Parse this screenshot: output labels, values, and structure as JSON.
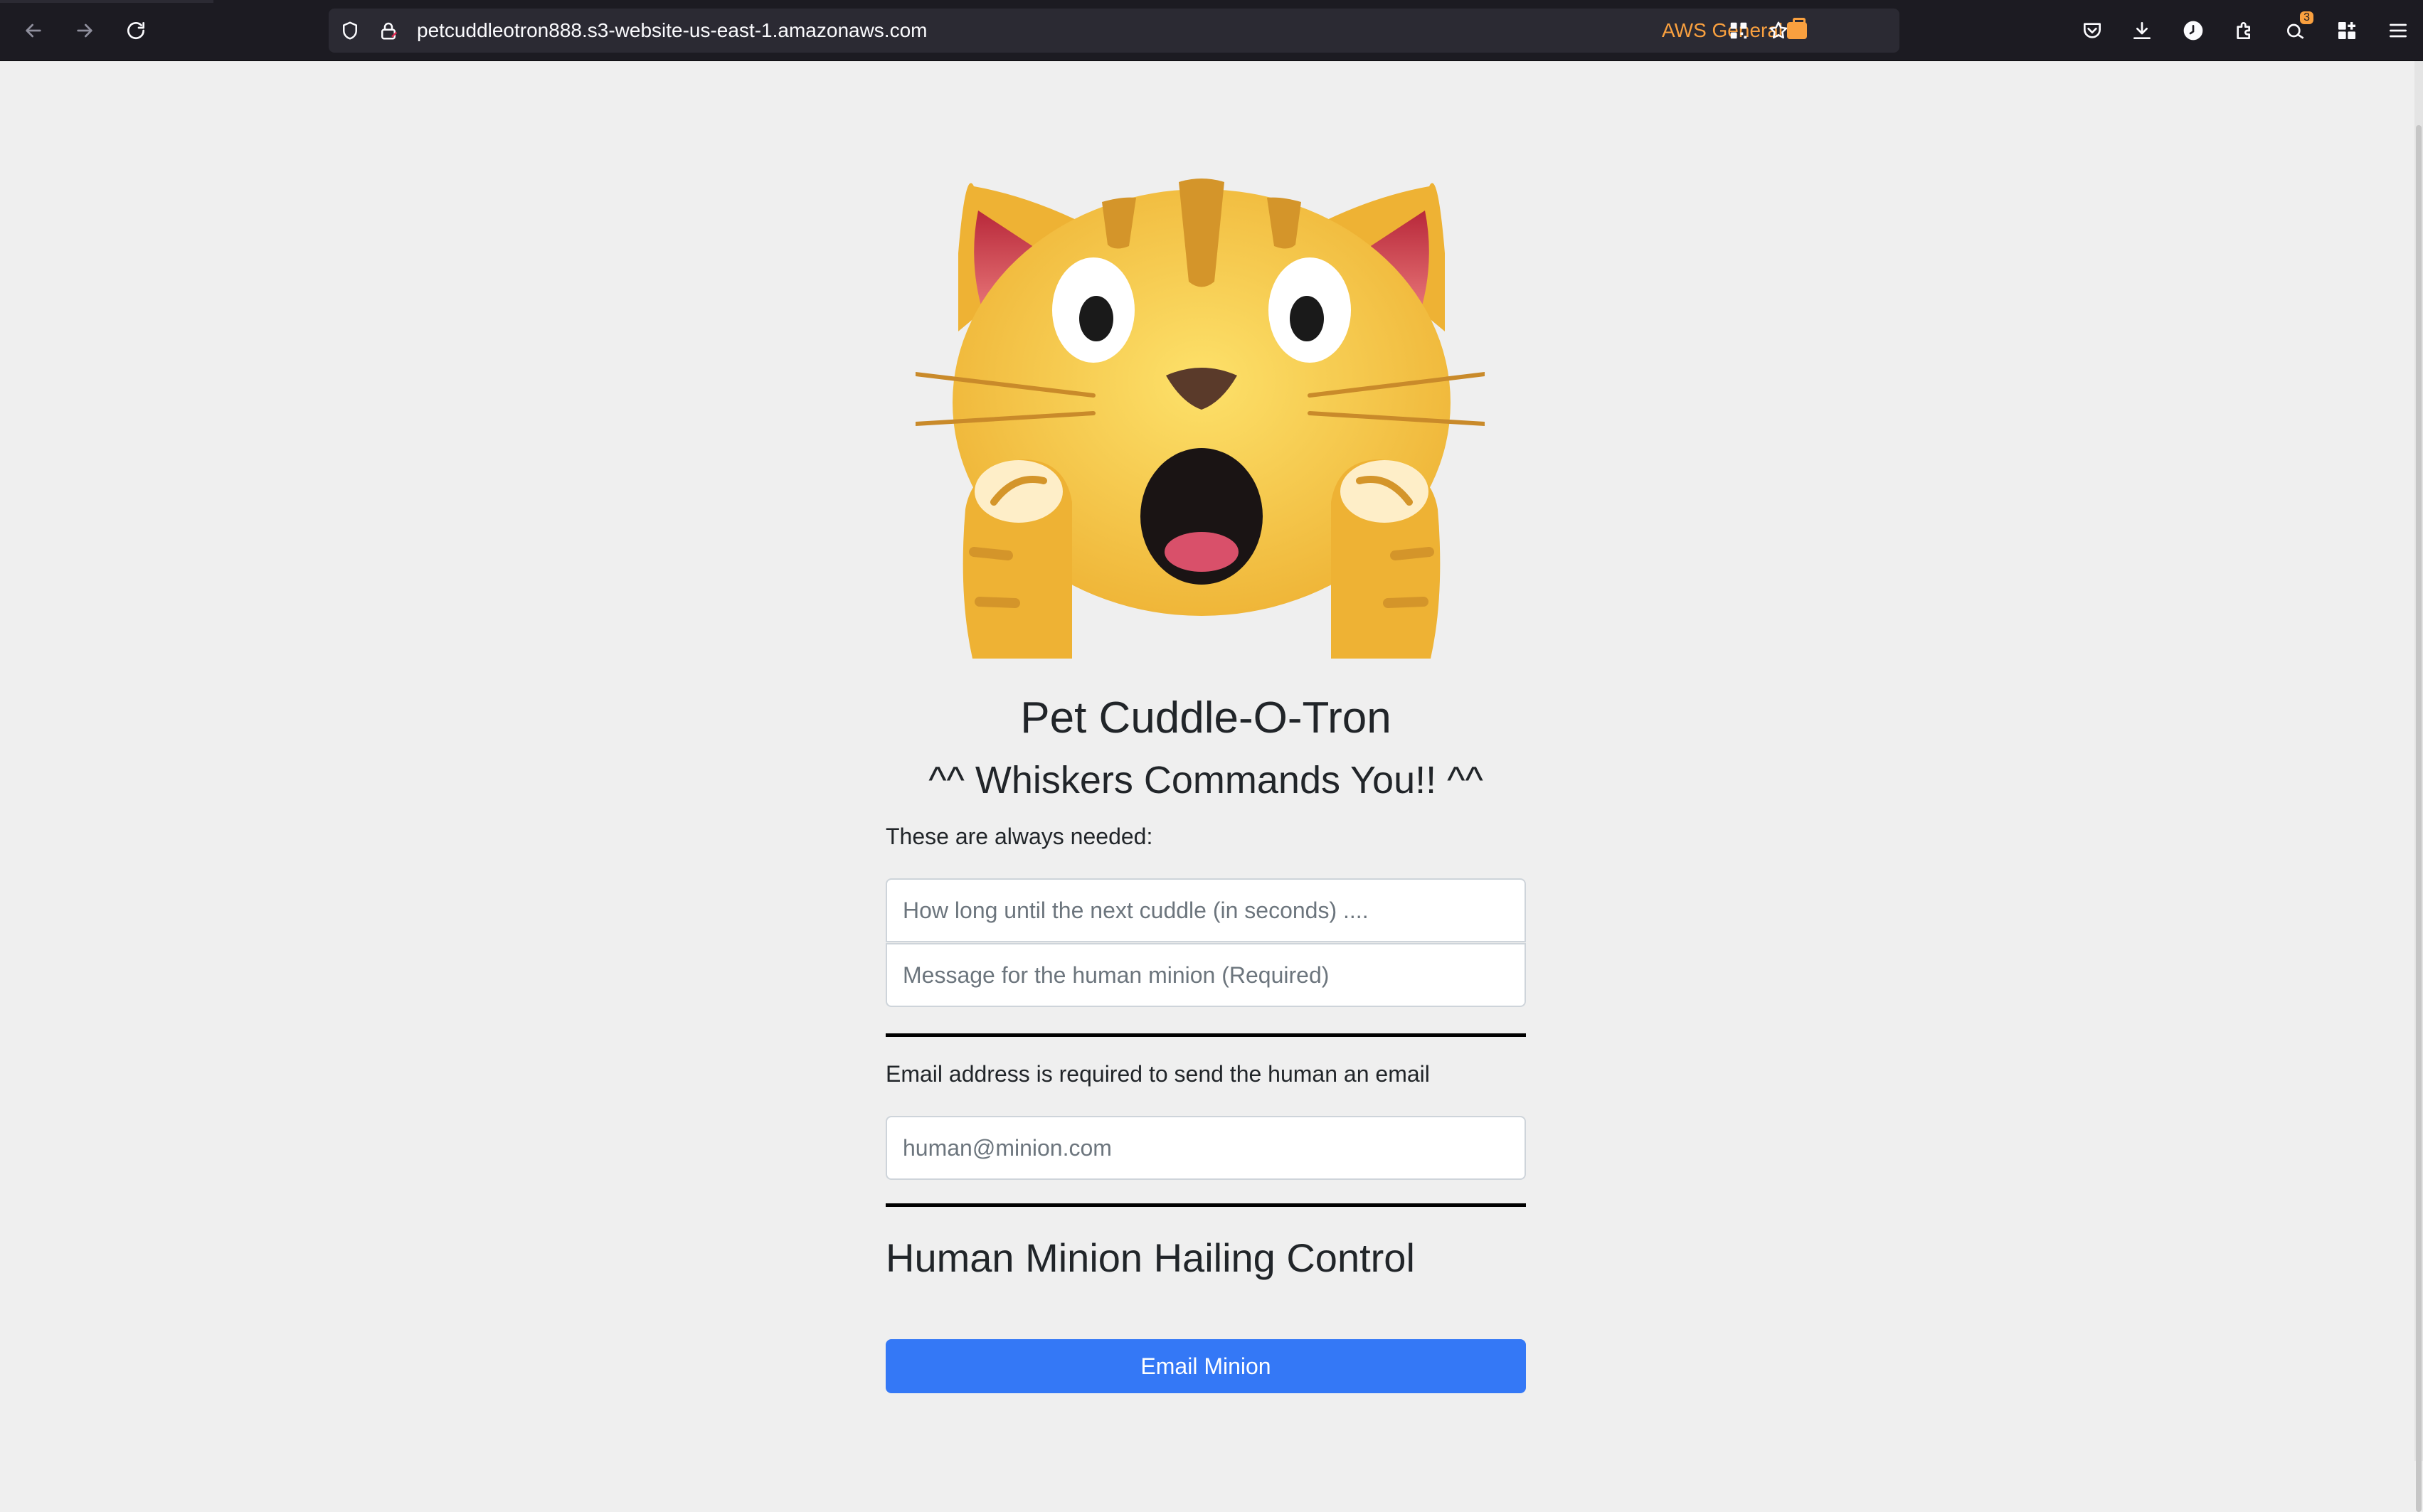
{
  "browser": {
    "url": "petcuddleotron888.s3-website-us-east-1.amazonaws.com",
    "container_label": "AWS General",
    "extension_badge": "3",
    "icons": {
      "back": "back-arrow-icon",
      "forward": "forward-arrow-icon",
      "reload": "reload-icon",
      "shield": "tracking-shield-icon",
      "lock": "lock-icon",
      "container": "briefcase-icon",
      "qr": "qr-code-icon",
      "bookmark": "star-icon",
      "pocket": "pocket-icon",
      "downloads": "download-icon",
      "account": "account-icon",
      "extensions": "puzzle-icon",
      "extension_badge": "extension-badge-icon",
      "addons": "addons-grid-icon",
      "menu": "hamburger-menu-icon"
    },
    "colors": {
      "chrome_bg": "#1c1b22",
      "urlbar_bg": "#2b2a33",
      "container_accent": "#f9a03f"
    }
  },
  "page": {
    "image_alt": "scared cat emoji",
    "title": "Pet Cuddle-O-Tron",
    "subtitle": "^^ Whiskers Commands You!! ^^",
    "always_needed_label": "These are always needed:",
    "cuddle_input": {
      "placeholder": "How long until the next cuddle (in seconds) ....",
      "value": ""
    },
    "message_input": {
      "placeholder": "Message for the human minion (Required)",
      "value": ""
    },
    "email_label": "Email address is required to send the human an email",
    "email_input": {
      "placeholder": "human@minion.com",
      "value": ""
    },
    "section_heading": "Human Minion Hailing Control",
    "email_button": "Email Minion",
    "colors": {
      "page_bg": "#efefef",
      "button_bg": "#3478f6",
      "text": "#212529"
    }
  }
}
